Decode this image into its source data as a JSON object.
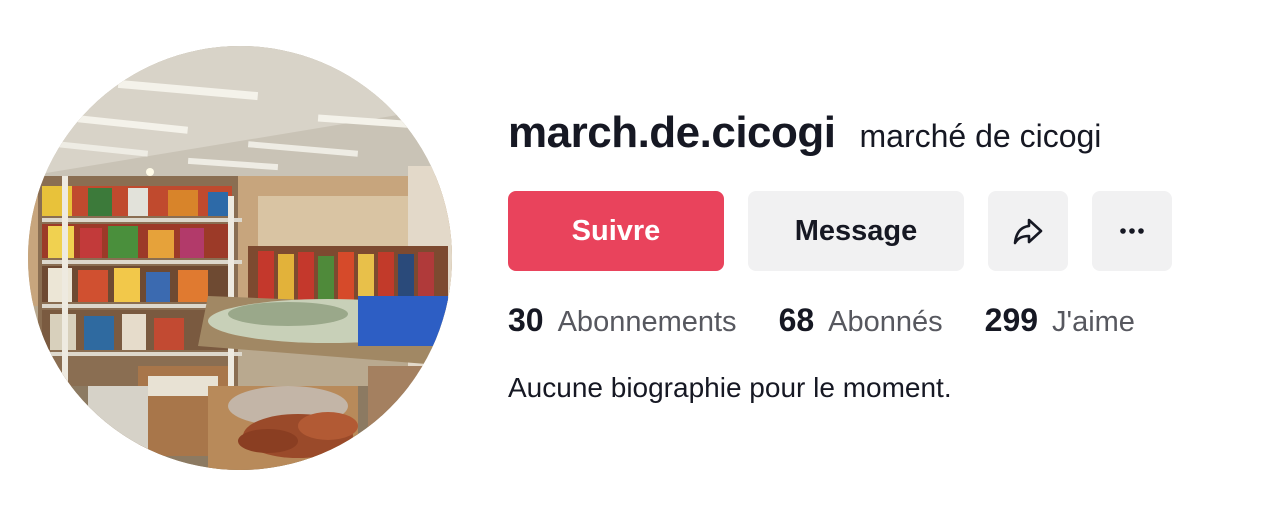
{
  "profile": {
    "username": "march.de.cicogi",
    "nickname": "marché de cicogi",
    "avatar_alt": "avatar-photo-grocery-store"
  },
  "actions": {
    "follow_label": "Suivre",
    "message_label": "Message",
    "share_icon": "share-arrow-icon",
    "more_icon": "more-dots-icon"
  },
  "stats": {
    "following_count": "30",
    "following_label": "Abonnements",
    "followers_count": "68",
    "followers_label": "Abonnés",
    "likes_count": "299",
    "likes_label": "J'aime"
  },
  "bio": "Aucune biographie pour le moment.",
  "colors": {
    "follow_button": "#e9435c",
    "secondary_button": "#f1f1f2",
    "text_primary": "#161823",
    "text_secondary": "#57585f"
  }
}
